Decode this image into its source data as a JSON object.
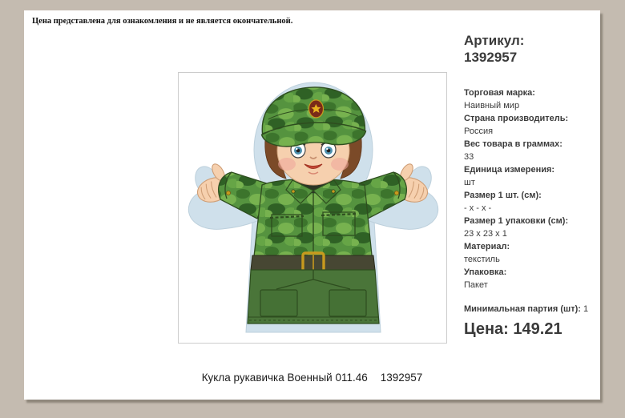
{
  "disclaimer": "Цена представлена для ознакомления и не является окончательной.",
  "article": {
    "label": "Артикул:",
    "number": "1392957"
  },
  "attributes": [
    {
      "label": "Торговая марка:",
      "value": "Наивный мир"
    },
    {
      "label": "Страна производитель:",
      "value": "Россия"
    },
    {
      "label": "Вес товара в граммах:",
      "value": "33"
    },
    {
      "label": "Единица измерения:",
      "value": "шт"
    },
    {
      "label": "Размер 1 шт. (см):",
      "value": "- x - x -"
    },
    {
      "label": "Размер 1 упаковки (см):",
      "value": "23 x 23 x 1"
    },
    {
      "label": "Материал:",
      "value": "текстиль"
    },
    {
      "label": "Упаковка:",
      "value": "Пакет"
    }
  ],
  "min_batch": {
    "label": "Минимальная партия (шт):",
    "value": "1"
  },
  "price": {
    "label": "Цена:",
    "value": "149.21"
  },
  "caption": {
    "name": "Кукла рукавичка Военный 011.46",
    "code": "1392957"
  },
  "image": {
    "alt": "Кукла рукавичка Военный — солдат в камуфляже"
  },
  "colors": {
    "background": "#c4bbb0",
    "page": "#ffffff",
    "text": "#3b3b3b",
    "frame_border": "#cccccc",
    "puppet_backing_blue": "#cfe0eb",
    "uniform_green": "#55933f",
    "skin": "#f6d0ae",
    "belt": "#474733",
    "buckle_gold": "#c79a1e"
  }
}
